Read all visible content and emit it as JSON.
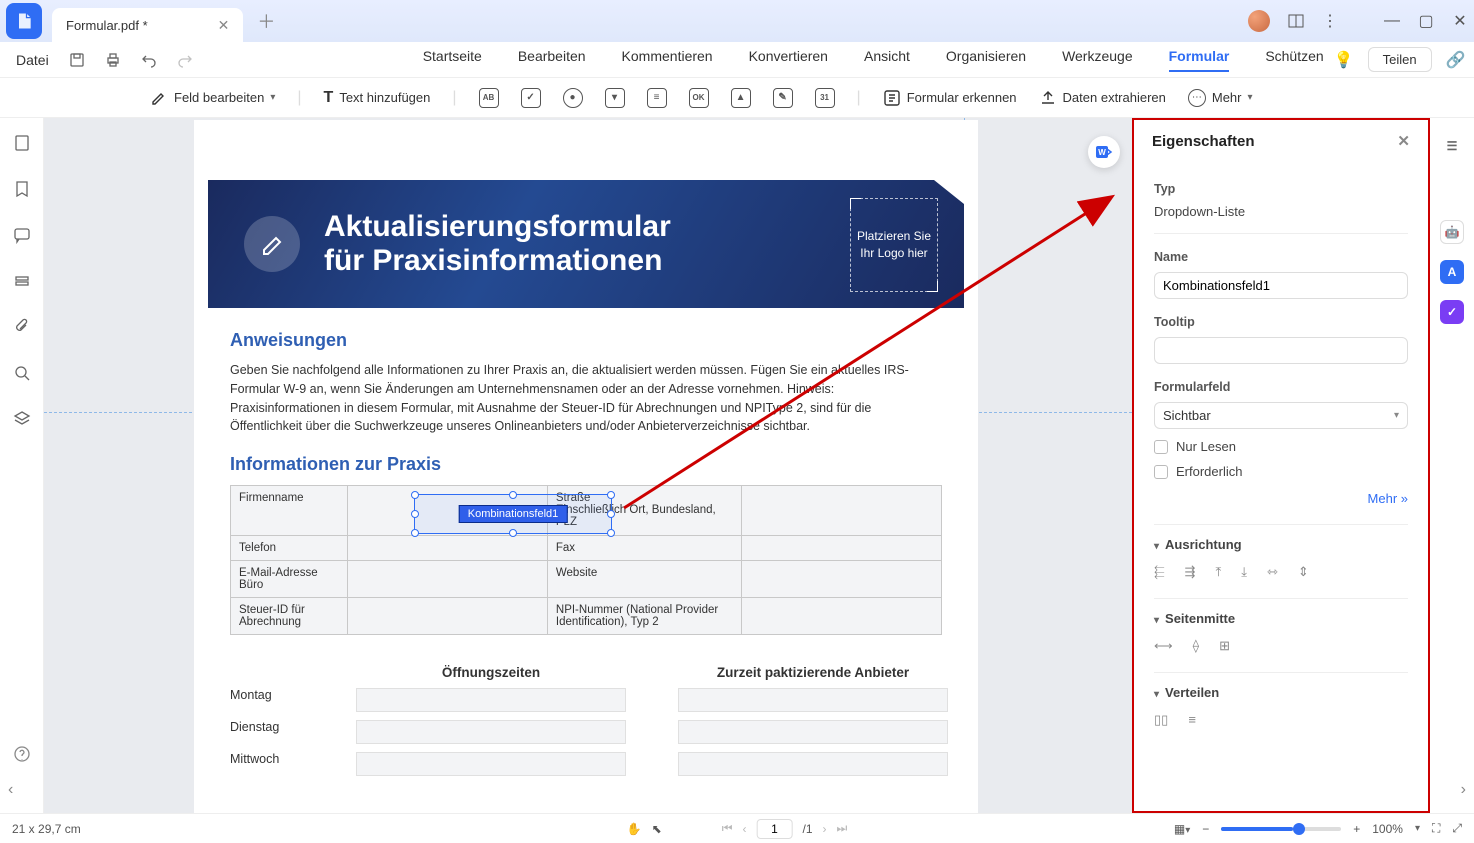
{
  "tab_title": "Formular.pdf *",
  "menu_file": "Datei",
  "menu_items": [
    "Startseite",
    "Bearbeiten",
    "Kommentieren",
    "Konvertieren",
    "Ansicht",
    "Organisieren",
    "Werkzeuge",
    "Formular",
    "Schützen"
  ],
  "share_label": "Teilen",
  "toolbar": {
    "edit_field": "Feld bearbeiten",
    "add_text": "Text hinzufügen",
    "recognize": "Formular erkennen",
    "extract": "Daten extrahieren",
    "more": "Mehr"
  },
  "doc": {
    "banner_line1": "Aktualisierungsformular",
    "banner_line2": "für Praxisinformationen",
    "logo_placeholder": "Platzieren Sie Ihr Logo hier",
    "instructions_h": "Anweisungen",
    "instructions_p": "Geben Sie nachfolgend alle Informationen zu Ihrer Praxis an, die aktualisiert werden müssen. Fügen Sie ein aktuelles IRS-Formular W-9 an, wenn Sie Änderungen am Unternehmensnamen oder an der Adresse vornehmen. Hinweis: Praxisinformationen in diesem Formular, mit Ausnahme der Steuer-ID für Abrechnungen und NPIType 2, sind für die Öffentlichkeit über die Suchwerkzeuge unseres Onlineanbieters und/oder Anbieterverzeichnisse sichtbar.",
    "section2_h": "Informationen zur Praxis",
    "labels": {
      "firmenname": "Firmenname",
      "strasse": "Straße\nEinschließlich Ort, Bundesland, PLZ",
      "telefon": "Telefon",
      "fax": "Fax",
      "email": "E-Mail-Adresse Büro",
      "website": "Website",
      "steuer": "Steuer-ID für Abrechnung",
      "npi": "NPI-Nummer (National Provider Identification), Typ 2"
    },
    "field_label": "Kombinationsfeld1",
    "hours": {
      "h1": "Öffnungszeiten",
      "h2": "Zurzeit paktizierende Anbieter",
      "mon": "Montag",
      "tue": "Dienstag",
      "wed": "Mittwoch"
    }
  },
  "props": {
    "title": "Eigenschaften",
    "type_lbl": "Typ",
    "type_val": "Dropdown-Liste",
    "name_lbl": "Name",
    "name_val": "Kombinationsfeld1",
    "tooltip_lbl": "Tooltip",
    "tooltip_val": "",
    "formfield_lbl": "Formularfeld",
    "formfield_val": "Sichtbar",
    "readonly": "Nur Lesen",
    "required": "Erforderlich",
    "more": "Mehr  »",
    "align_h": "Ausrichtung",
    "center_h": "Seitenmitte",
    "dist_h": "Verteilen"
  },
  "status": {
    "dims": "21 x 29,7 cm",
    "page": "1",
    "total": "/1",
    "zoom": "100%"
  }
}
